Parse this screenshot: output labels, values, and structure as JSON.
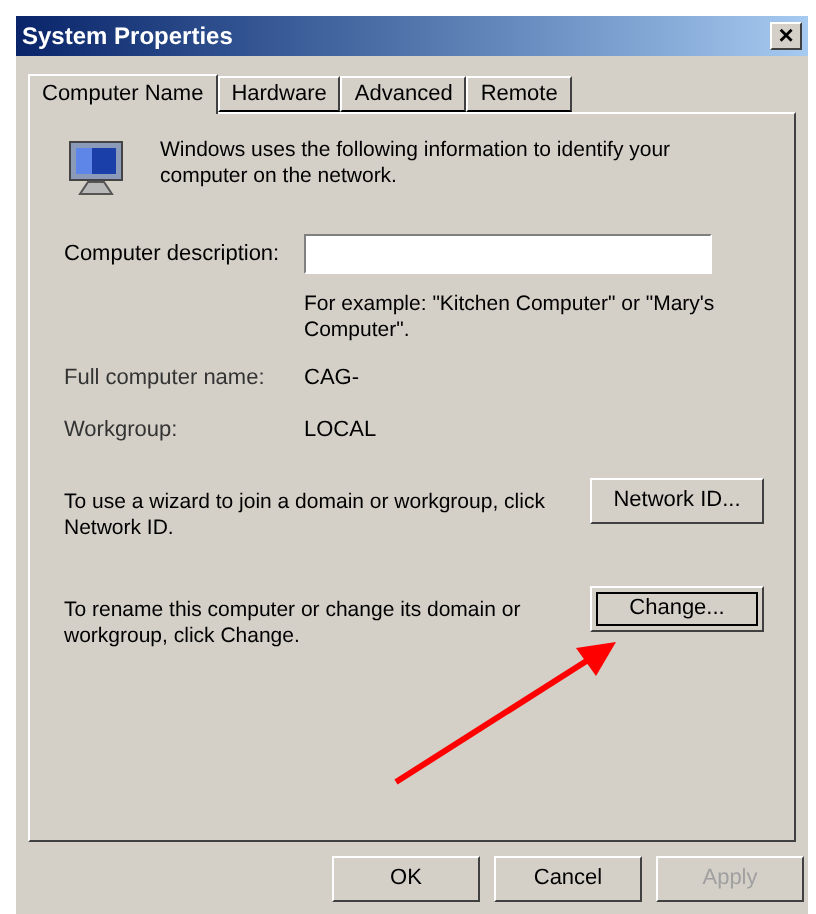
{
  "window": {
    "title": "System Properties",
    "close": "×"
  },
  "tabs": [
    {
      "label": "Computer Name",
      "selected": true
    },
    {
      "label": "Hardware",
      "selected": false
    },
    {
      "label": "Advanced",
      "selected": false
    },
    {
      "label": "Remote",
      "selected": false
    }
  ],
  "intro": "Windows uses the following information to identify your computer on the network.",
  "description": {
    "label": "Computer description:",
    "hint": "For example: \"Kitchen Computer\" or \"Mary's Computer\"."
  },
  "info": [
    {
      "label": "Full computer name:",
      "value": "CAG-"
    },
    {
      "label": "Workgroup:",
      "value": "LOCAL"
    }
  ],
  "actions": [
    {
      "text": "To use a wizard to join a domain or workgroup, click Network ID.",
      "button": "Network ID...",
      "focused": false
    },
    {
      "text": "To rename this computer or change its domain or workgroup, click Change.",
      "button": "Change...",
      "focused": true
    }
  ],
  "buttons": [
    {
      "label": "OK",
      "disabled": false
    },
    {
      "label": "Cancel",
      "disabled": false
    },
    {
      "label": "Apply",
      "disabled": true
    }
  ]
}
